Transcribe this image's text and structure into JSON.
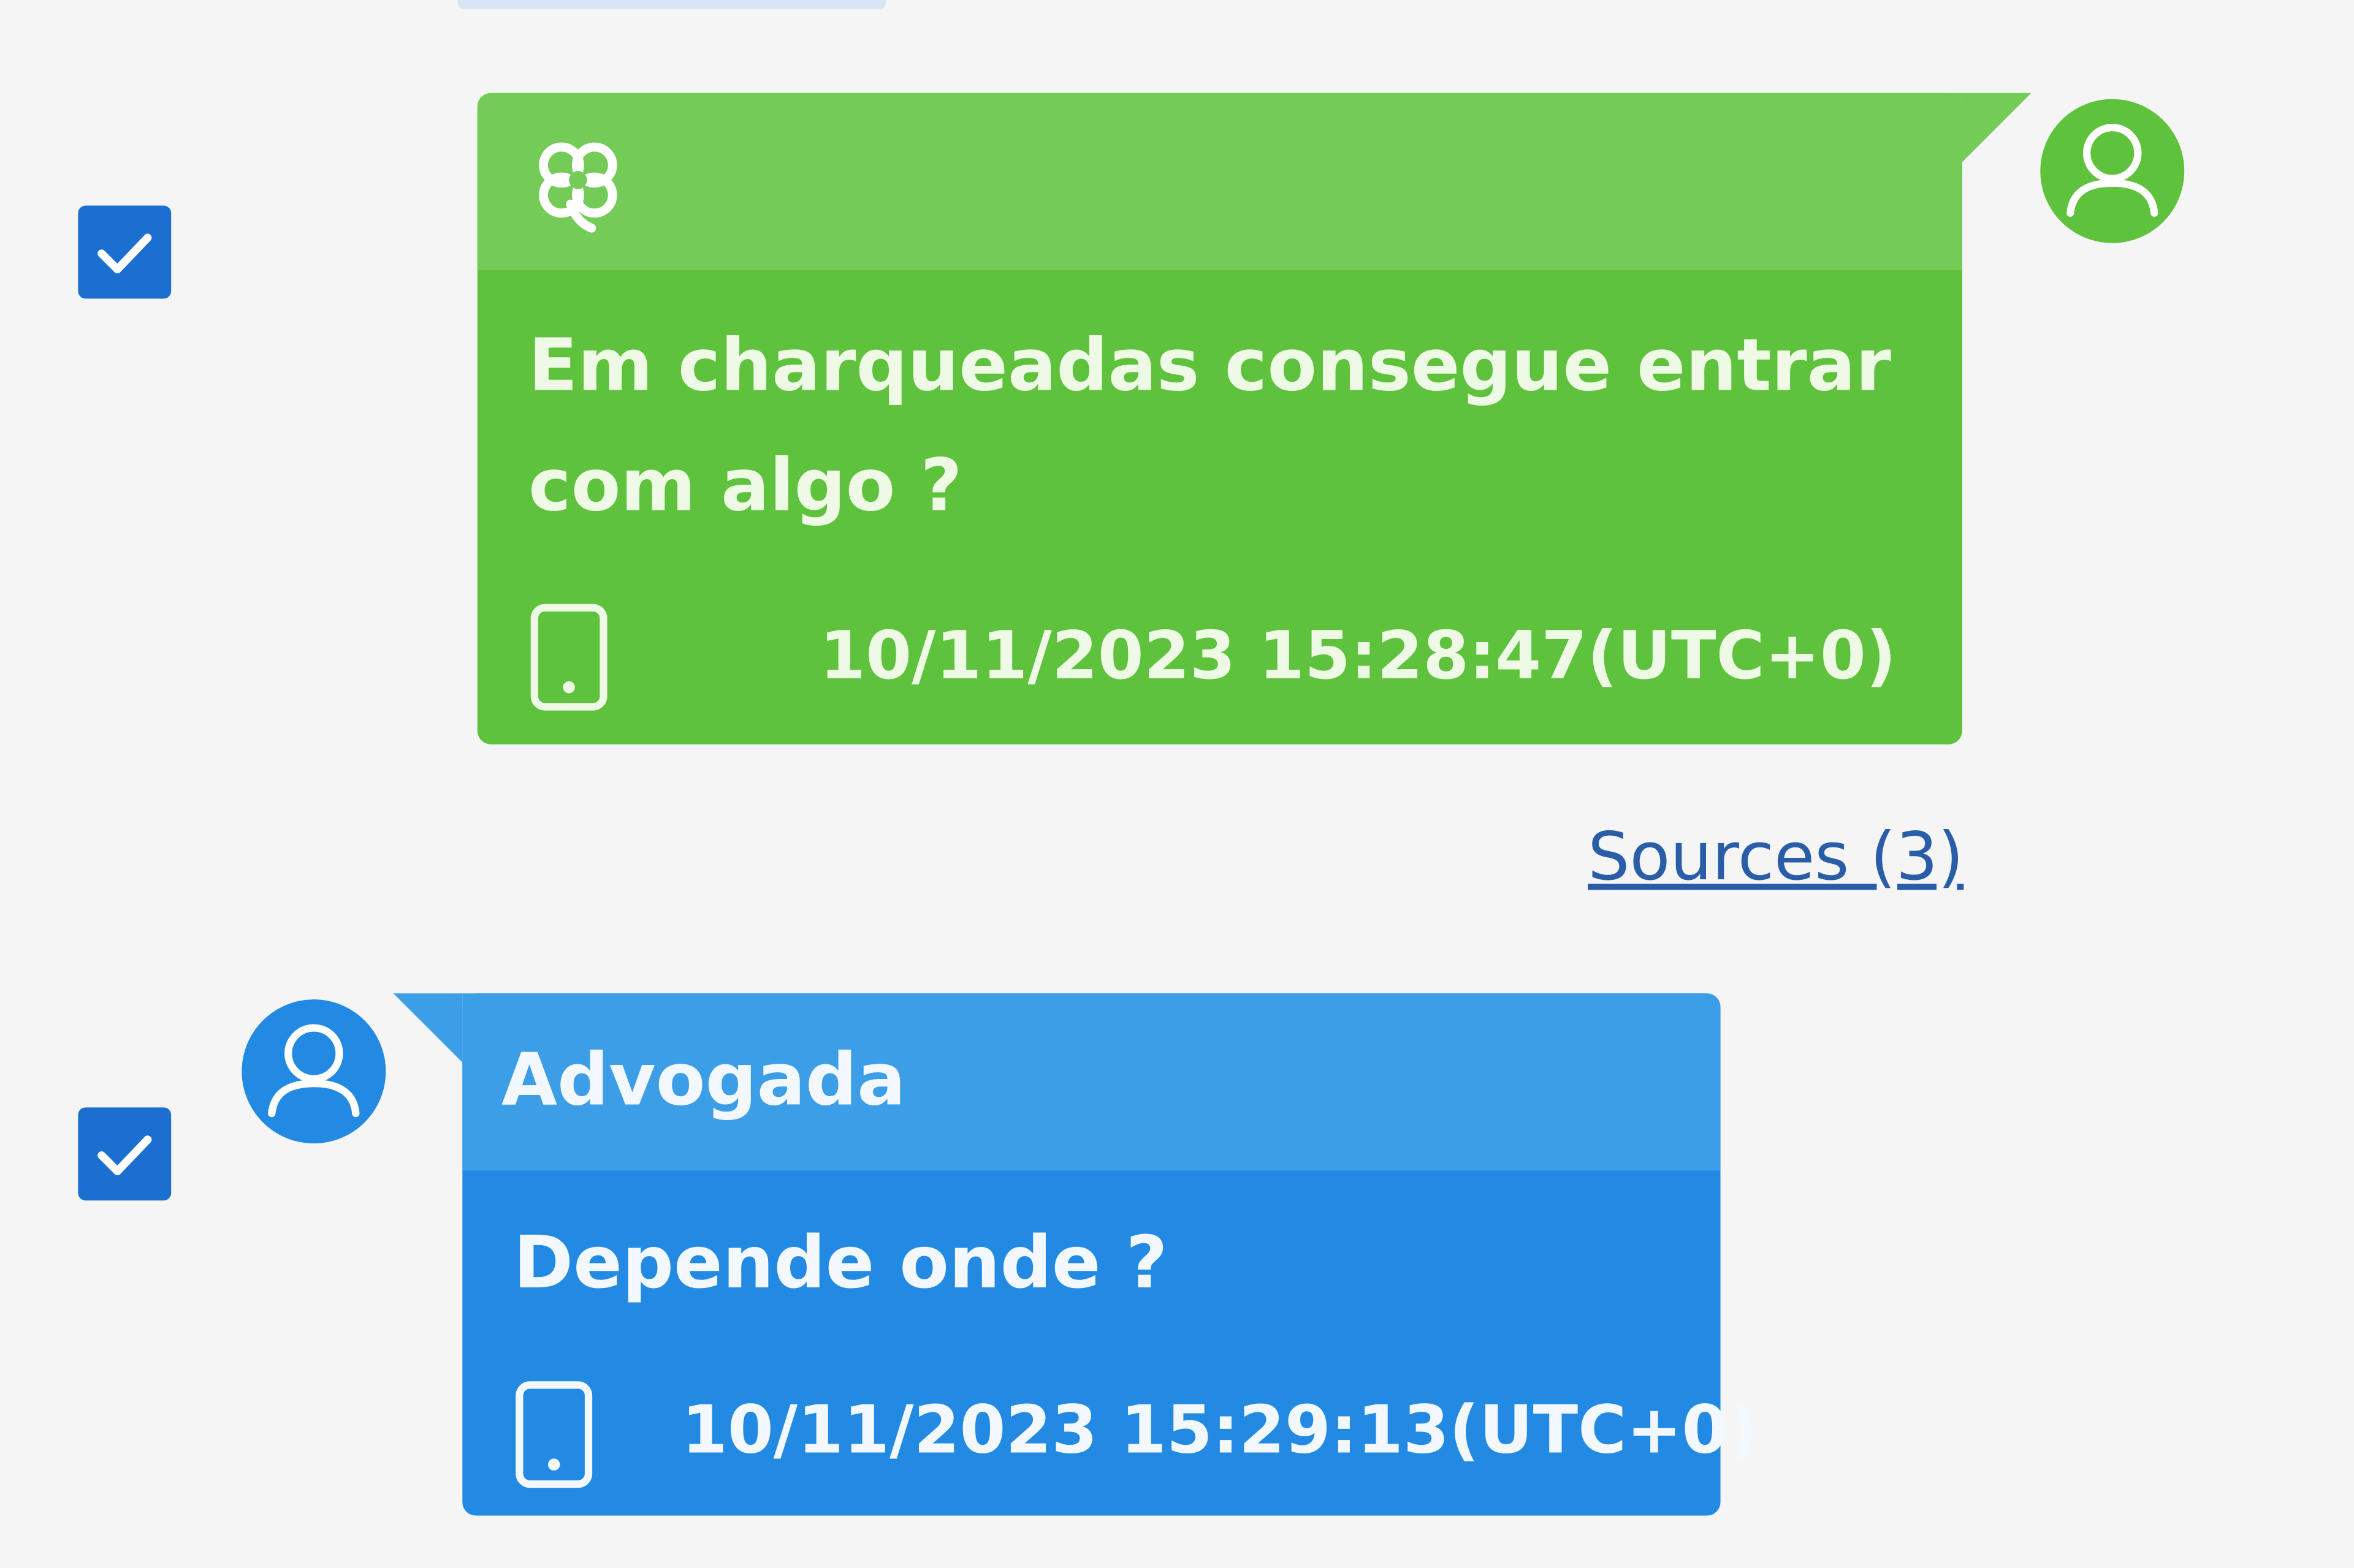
{
  "messages": [
    {
      "direction": "outgoing",
      "selected": true,
      "text": "Em charqueadas consegue entrar com algo ?",
      "timestamp": "10/11/2023 15:28:47(UTC+0)",
      "source_icon": "clover-icon",
      "device_icon": "phone-icon",
      "sources_label": "Sources (3)",
      "color": "#5ec23c"
    },
    {
      "direction": "incoming",
      "selected": true,
      "sender": "Advogada",
      "text": "Depende onde ?",
      "timestamp": "10/11/2023 15:29:13(UTC+0)",
      "device_icon": "phone-icon",
      "color": "#238ae3"
    }
  ]
}
